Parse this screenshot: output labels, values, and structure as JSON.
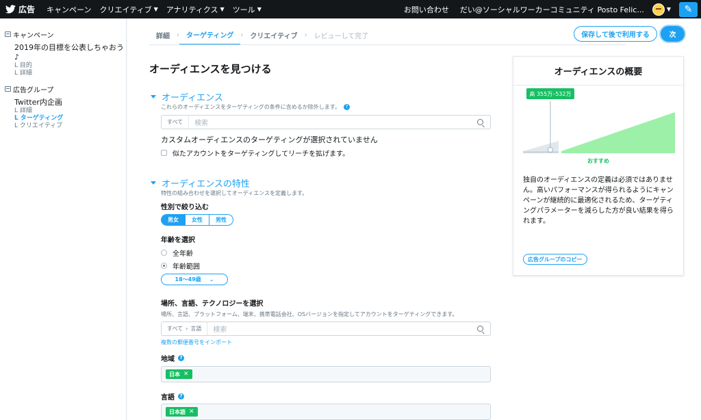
{
  "topbar": {
    "brand_label": "広告",
    "nav": [
      {
        "label": "キャンペーン",
        "has_caret": false
      },
      {
        "label": "クリエイティブ",
        "has_caret": true
      },
      {
        "label": "アナリティクス",
        "has_caret": true
      },
      {
        "label": "ツール",
        "has_caret": true
      }
    ],
    "help_label": "お問い合わせ",
    "account_label": "だい@ソーシャルワーカーコミュニティ Posto Felic...",
    "compose_icon": "compose-icon"
  },
  "sidebar": {
    "campaign_section": "キャンペーン",
    "campaign_name": "2019年の目標を公表しちゃおう♪",
    "campaign_subs": [
      "目的",
      "詳細"
    ],
    "adgroup_section": "広告グループ",
    "adgroup_name": "Twitter内企画",
    "adgroup_subs": [
      {
        "label": "詳細",
        "active": false
      },
      {
        "label": "ターゲティング",
        "active": true
      },
      {
        "label": "クリエイティブ",
        "active": false
      }
    ]
  },
  "steps": {
    "items": [
      "詳細",
      "ターゲティング",
      "クリエイティブ",
      "レビューして完了"
    ],
    "active_index": 1,
    "save_label": "保存して後で利用する",
    "next_label": "次"
  },
  "main": {
    "page_title": "オーディエンスを見つける",
    "audience": {
      "title": "オーディエンス",
      "desc": "これらのオーディエンスをターゲティングの条件に含めるか除外します。",
      "search_scope": "すべて",
      "search_placeholder": "検索",
      "none_selected": "カスタムオーディエンスのターゲティングが選択されていません",
      "lookalike_label": "似たアカウントをターゲティングしてリーチを拡げます。"
    },
    "features": {
      "title": "オーディエンスの特性",
      "desc": "特性の組み合わせを選択してオーディエンスを定義します。",
      "gender_label": "性別で絞り込む",
      "gender_options": [
        "男女",
        "女性",
        "男性"
      ],
      "gender_selected": 0,
      "age_label": "年齢を選択",
      "age_all": "全年齢",
      "age_range": "年齢範囲",
      "age_range_value": "18〜49歳",
      "location_label": "場所、言語、テクノロジーを選択",
      "location_desc": "場所、言語、プラットフォーム、端末、携帯電話会社、OSバージョンを指定してアカウントをターゲティングできます。",
      "location_scope": "すべて",
      "location_scope_sub": "言語",
      "location_placeholder": "検索",
      "postal_import": "複数の郵便番号をインポート",
      "region_label": "地域",
      "region_tag": "日本",
      "language_label": "言語",
      "language_tag": "日本語"
    }
  },
  "panel": {
    "title": "オーディエンスの概要",
    "estimate_label": "高 355万–532万",
    "recommend_label": "おすすめ",
    "marker_position_fraction": 0.18,
    "body": "独自のオーディエンスの定義は必須ではありません。高いパフォーマンスが得られるようにキャンペーンが継続的に最適化されるため、ターゲティングパラメーターを減らした方が良い結果を得られます。",
    "copy_label": "広告グループのコピー"
  },
  "colors": {
    "accent": "#1da1f2",
    "topbar": "#14171a",
    "tag_green": "#17bf63",
    "chart_green": "#9cf0a8"
  }
}
